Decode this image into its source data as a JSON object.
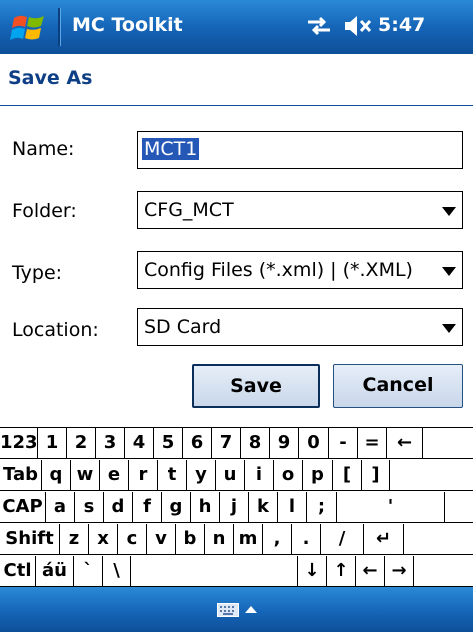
{
  "titlebar": {
    "app_title": "MC Toolkit",
    "time": "5:47",
    "start_icon": "windows-flag-icon",
    "connectivity_icon": "sync-arrows-icon",
    "volume_icon": "speaker-muted-icon"
  },
  "header": {
    "title": "Save As"
  },
  "form": {
    "name_label": "Name:",
    "name_value": "MCT1",
    "folder_label": "Folder:",
    "folder_value": "CFG_MCT",
    "type_label": "Type:",
    "type_value": "Config Files (*.xml) | (*.XML)",
    "location_label": "Location:",
    "location_value": "SD Card"
  },
  "buttons": {
    "save": "Save",
    "cancel": "Cancel"
  },
  "keyboard": {
    "rows": [
      [
        "123",
        "1",
        "2",
        "3",
        "4",
        "5",
        "6",
        "7",
        "8",
        "9",
        "0",
        "-",
        "=",
        "←"
      ],
      [
        "Tab",
        "q",
        "w",
        "e",
        "r",
        "t",
        "y",
        "u",
        "i",
        "o",
        "p",
        "[",
        "]"
      ],
      [
        "CAP",
        "a",
        "s",
        "d",
        "f",
        "g",
        "h",
        "j",
        "k",
        "l",
        ";",
        "'"
      ],
      [
        "Shift",
        "z",
        "x",
        "c",
        "v",
        "b",
        "n",
        "m",
        ",",
        ".",
        "/",
        "↵"
      ],
      [
        "Ctl",
        "áü",
        "`",
        "\\",
        " ",
        "↓",
        "↑",
        "←",
        "→"
      ]
    ]
  },
  "bottombar": {
    "sip_icon": "keyboard-icon",
    "sip_arrow": "up-arrow-icon"
  },
  "colors": {
    "titlebar": "#1565b8",
    "header_text": "#0e3f86",
    "selection": "#2557b6"
  }
}
